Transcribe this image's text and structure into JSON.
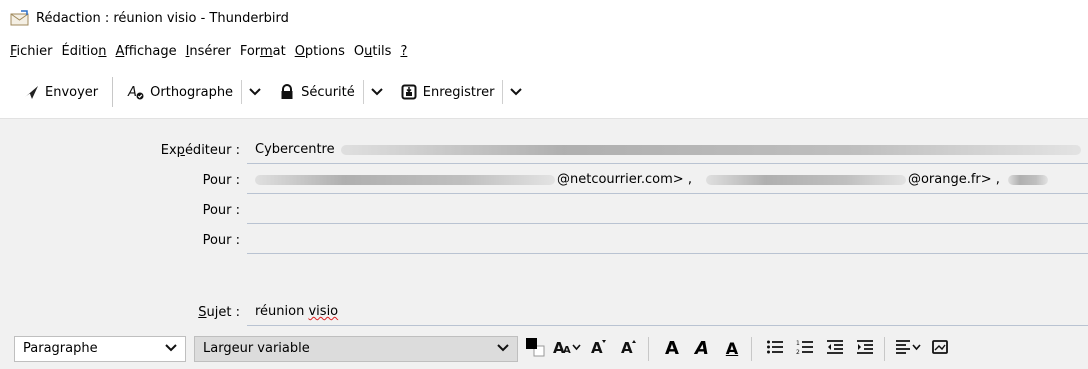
{
  "window": {
    "title": "Rédaction : réunion visio - Thunderbird",
    "icon": "compose-envelope-icon"
  },
  "menubar": {
    "items": [
      {
        "pre": "",
        "key": "F",
        "post": "ichier"
      },
      {
        "pre": "Éditio",
        "key": "n",
        "post": ""
      },
      {
        "pre": "",
        "key": "A",
        "post": "ffichage"
      },
      {
        "pre": "",
        "key": "I",
        "post": "nsérer"
      },
      {
        "pre": "For",
        "key": "m",
        "post": "at"
      },
      {
        "pre": "",
        "key": "O",
        "post": "ptions"
      },
      {
        "pre": "O",
        "key": "u",
        "post": "tils"
      },
      {
        "pre": "",
        "key": "?",
        "post": ""
      }
    ]
  },
  "toolbar": {
    "send_label": "Envoyer",
    "spelling_label": "Orthographe",
    "security_label": "Sécurité",
    "save_label": "Enregistrer"
  },
  "headers": {
    "from_label": "Expéditeur :",
    "from_value": "Cybercentre",
    "to_label": "Pour :",
    "to_recipient_1": "@netcourrier.com> ,",
    "to_recipient_2": "@orange.fr> ,",
    "to_label_2": "Pour :",
    "to_label_3": "Pour :",
    "subject_label": "Sujet :",
    "subject_value_word1": "réunion",
    "subject_value_word2": "visio"
  },
  "formatbar": {
    "paragraph_value": "Paragraphe",
    "font_value": "Largeur variable"
  },
  "colors": {
    "header_bg": "#f1f1f1",
    "field_underline": "#b9c3d2",
    "spell_error": "#dd2222"
  }
}
